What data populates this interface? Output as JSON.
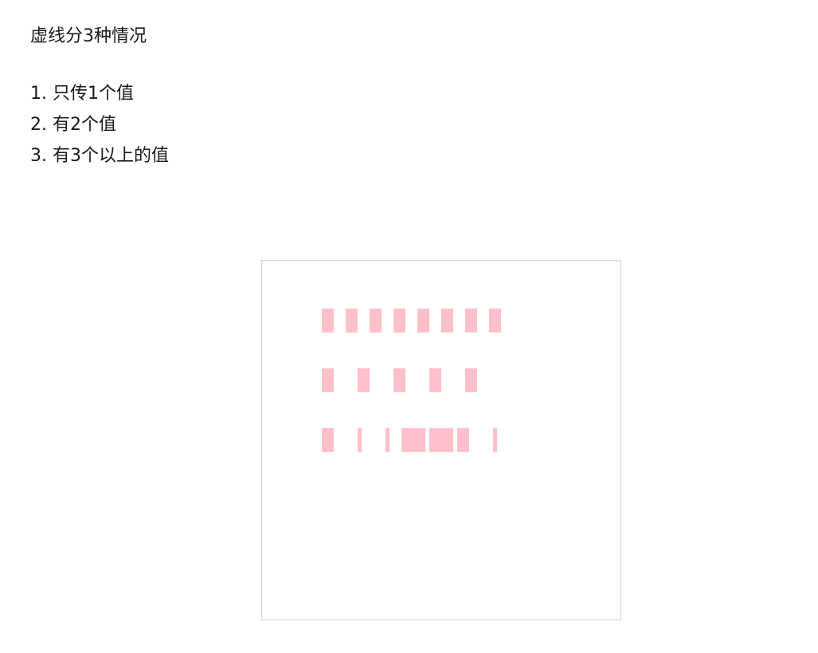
{
  "intro": {
    "heading": "虚线分3种情况",
    "items": [
      "1. 只传1个值",
      "2. 有2个值",
      "3. 有3个以上的值"
    ]
  },
  "canvas": {
    "stroke_color": "#ffc0cb",
    "border_color": "#d3d3d3",
    "lines": [
      {
        "name": "dash-line-one-value",
        "pattern": [
          15
        ]
      },
      {
        "name": "dash-line-two-values",
        "pattern": [
          15,
          30
        ]
      },
      {
        "name": "dash-line-three-plus-values",
        "pattern": [
          15,
          30,
          5,
          30,
          5
        ]
      }
    ]
  }
}
